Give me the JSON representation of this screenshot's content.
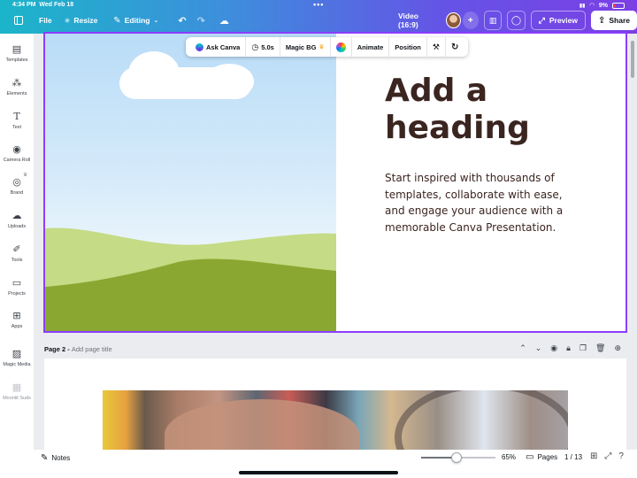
{
  "status": {
    "time": "4:34 PM",
    "date": "Wed Feb 18",
    "battery": "9%"
  },
  "toolbar": {
    "file": "File",
    "resize": "Resize",
    "editing": "Editing",
    "format": "Video (16:9)",
    "preview": "Preview",
    "share": "Share",
    "add": "+"
  },
  "sidebar": {
    "items": [
      {
        "label": "Templates",
        "icon": "templates-icon"
      },
      {
        "label": "Elements",
        "icon": "elements-icon"
      },
      {
        "label": "Text",
        "icon": "text-icon"
      },
      {
        "label": "Camera Roll",
        "icon": "camera-icon"
      },
      {
        "label": "Brand",
        "icon": "brand-icon"
      },
      {
        "label": "Uploads",
        "icon": "uploads-icon"
      },
      {
        "label": "Tools",
        "icon": "tools-icon"
      },
      {
        "label": "Projects",
        "icon": "projects-icon"
      },
      {
        "label": "Apps",
        "icon": "apps-icon"
      },
      {
        "label": "Magic Media",
        "icon": "magic-media-icon"
      },
      {
        "label": "Moonlit Suds",
        "icon": "moonlit-suds-icon"
      }
    ]
  },
  "context_toolbar": {
    "ask_canva": "Ask Canva",
    "duration": "5.0s",
    "magic_bg": "Magic BG",
    "animate": "Animate",
    "position": "Position"
  },
  "slide1": {
    "heading": "Add a heading",
    "body": "Start inspired with thousands of templates, collaborate with ease, and engage your audience with a memorable Canva Presentation."
  },
  "page2": {
    "label": "Page 2 -",
    "title_placeholder": "Add page title"
  },
  "bottom": {
    "notes": "Notes",
    "zoom": "65%",
    "pages": "Pages",
    "page_count": "1 / 13",
    "zoom_fraction": 0.5
  },
  "colors": {
    "accent": "#8b3dff",
    "heading_text": "#3b2520",
    "sky": "#cfe6f8",
    "hill_light": "#c5db85",
    "hill_dark": "#8aa831"
  }
}
